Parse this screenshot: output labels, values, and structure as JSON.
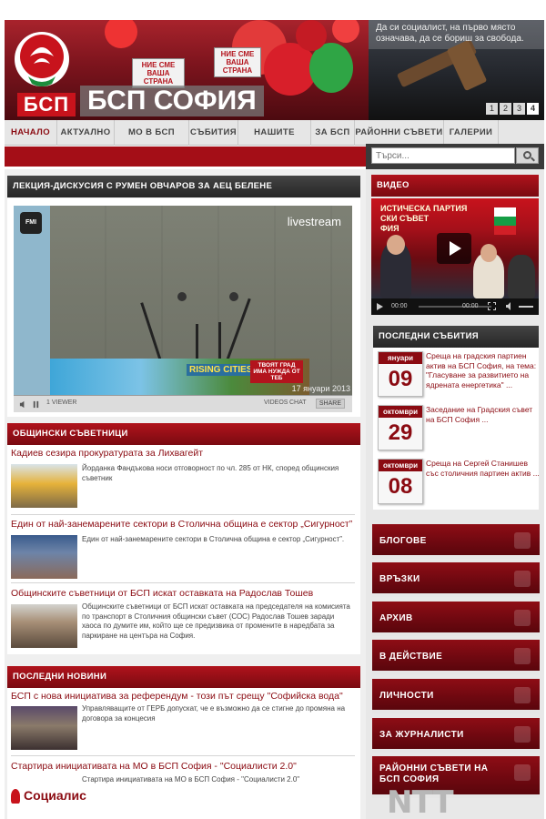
{
  "header": {
    "logo_text": "БСП",
    "site_title": "БСП СОФИЯ",
    "quote": "Да си социалист, на първо място означава, да се бориш за свобода.",
    "banner_text": "НИЕ СМЕ ВАША СТРАНА",
    "slider_pages": [
      "1",
      "2",
      "3",
      "4"
    ],
    "slider_active": 3
  },
  "nav": {
    "items": [
      "НАЧАЛО",
      "АКТУАЛНО",
      "МО В БСП СОФИЯ",
      "СЪБИТИЯ",
      "НАШИТЕ ЛИДЕРИ",
      "ЗА БСП",
      "РАЙОННИ СЪВЕТИ",
      "ГАЛЕРИИ"
    ],
    "active": 0
  },
  "search": {
    "placeholder": "Търси..."
  },
  "lecture": {
    "heading": "ЛЕКЦИЯ-ДИСКУСИЯ С РУМЕН ОВЧАРОВ ЗА АЕЦ БЕЛЕНЕ",
    "player": {
      "badge": "FMI",
      "brand": "livestream",
      "ad_title": "RISING CITIES",
      "ad_note": "ТВОЯТ ГРАД ИМА НУЖДА ОТ ТЕБ",
      "date": "17 януари 2013",
      "viewers": "1 VIEWER",
      "videos": "VIDEOS",
      "chat": "CHAT",
      "share": "SHARE"
    }
  },
  "councilors": {
    "heading": "ОБЩИНСКИ СЪВЕТНИЦИ",
    "articles": [
      {
        "title": "Кадиев сезира прокуратурата за Лихвагейт",
        "text": "Йорданка Фандъкова носи отговорност по чл. 285 от НК, според общинския съветник"
      },
      {
        "title": "Един от най-занемарените сектори в Столична община е сектор „Сигурност”",
        "text": "Един от най-занемарените сектори в Столична община е сектор „Сигурност”."
      },
      {
        "title": "Общинските съветници от БСП искат оставката на Радослав Тошев",
        "text": "Общинските съветници от БСП искат оставката на председателя на комисията по транспорт в Столичния общински съвет (СОС) Радослав Тошев заради хаоса по думите им, който ще се предизвика от промените в наредбата за паркиране на центъра на София."
      }
    ]
  },
  "news": {
    "heading": "ПОСЛЕДНИ НОВИНИ",
    "articles": [
      {
        "title": "БСП с нова инициатива за референдум - този път срещу \"Софийска вода\"",
        "text": "Управляващите от ГЕРБ допускат, че е възможно да се стигне до промяна на договора за концесия"
      },
      {
        "title": "Стартира инициативата на МО в БСП София - \"Социалисти 2.0\"",
        "text": "Стартира инициативата на МО в БСП София - \"Социалисти 2.0\""
      }
    ],
    "footer_logo": "Социалис"
  },
  "sidebar": {
    "video_heading": "ВИДЕО",
    "video_scene_text": "ИСТИЧЕСКА ПАРТИЯ\nСКИ СЪВЕТ\nФИЯ",
    "video_time_start": "00:00",
    "video_time_end": "00:00",
    "events_heading": "ПОСЛЕДНИ СЪБИТИЯ",
    "events": [
      {
        "month": "януари",
        "day": "09",
        "text": "Среща на градския партиен актив на БСП София, на тема: \"Гласуване за развитието на ядрената енергетика\" ..."
      },
      {
        "month": "октомври",
        "day": "29",
        "text": "Заседание на Градския съвет на БСП София ..."
      },
      {
        "month": "октомври",
        "day": "08",
        "text": "Среща на Сергей Станишев със столичния партиен актив ..."
      }
    ],
    "menu": [
      "БЛОГОВЕ",
      "ВРЪЗКИ",
      "АРХИВ",
      "В ДЕЙСТВИЕ",
      "ЛИЧНОСТИ",
      "ЗА ЖУРНАЛИСТИ",
      "РАЙОННИ СЪВЕТИ НА БСП СОФИЯ"
    ]
  },
  "watermark": "NTT",
  "colors": {
    "brand_red": "#8b0b12",
    "accent_red": "#c8131c",
    "dark_header": "#262626"
  }
}
